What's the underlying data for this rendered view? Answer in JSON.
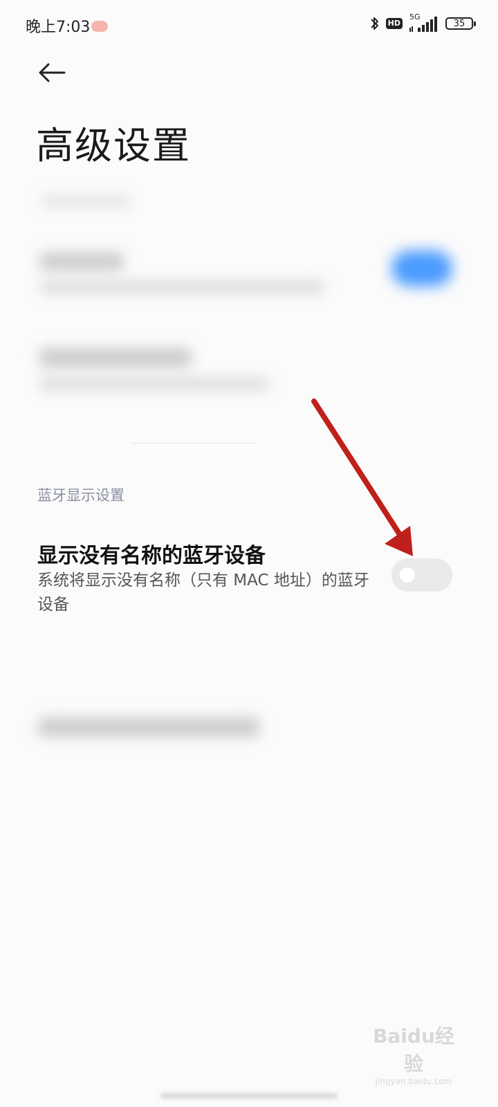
{
  "status_bar": {
    "time": "晚上7:03",
    "hd": "HD",
    "network": "5G",
    "battery": "35"
  },
  "header": {
    "back_icon": "arrow-left-icon",
    "title": "高级设置"
  },
  "section": {
    "header": "蓝牙显示设置",
    "item": {
      "title": "显示没有名称的蓝牙设备",
      "description": "系统将显示没有名称（只有 MAC 地址）的蓝牙设备",
      "toggle_state": "off"
    }
  },
  "watermark": {
    "logo": "Baidu经验",
    "url": "jingyan.baidu.com"
  },
  "colors": {
    "annotation_arrow": "#c0201b",
    "section_header": "#8a8fa3",
    "toggle_off": "#e9e9e9",
    "blurred_toggle": "#4b9bff"
  }
}
